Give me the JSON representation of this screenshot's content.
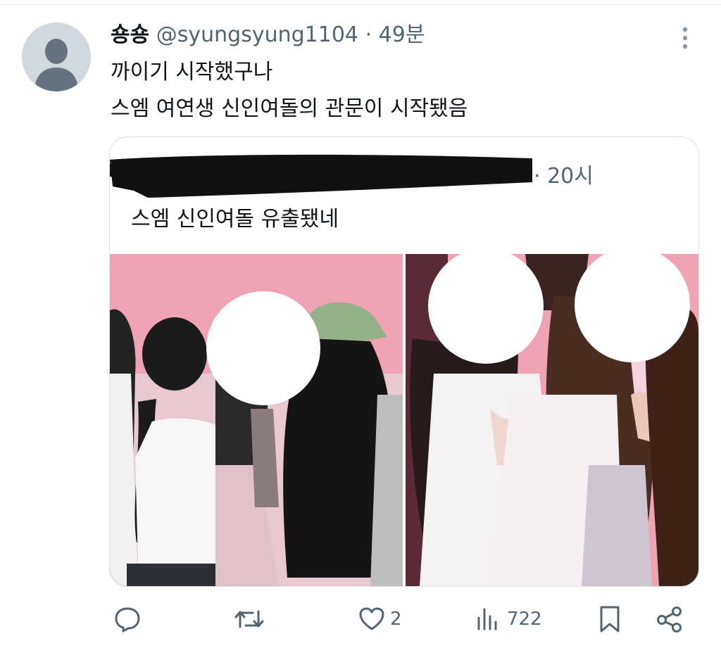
{
  "tweet": {
    "display_name": "숑숑",
    "handle": "@syungsyung1104",
    "separator": "·",
    "time": "49분",
    "body_line1": "까이기 시작했구나",
    "body_line2": "스엠 여연생 신인여돌의 관문이 시작됐음"
  },
  "quote": {
    "separator": "·",
    "time": "20시",
    "text": "스엠 신인여돌 유출됐네"
  },
  "actions": {
    "reply_icon": "speech-bubble",
    "retweet_icon": "repost-arrows",
    "like_icon": "heart-outline",
    "like_count": "2",
    "views_icon": "bar-chart",
    "views_count": "722",
    "bookmark_icon": "bookmark-outline",
    "share_icon": "share-nodes"
  },
  "colors": {
    "text_primary": "#0f1419",
    "text_secondary": "#536471",
    "border": "#dcdfe3",
    "avatar_bg": "#cfd9de",
    "photo_pink": "#f1a3b6"
  }
}
